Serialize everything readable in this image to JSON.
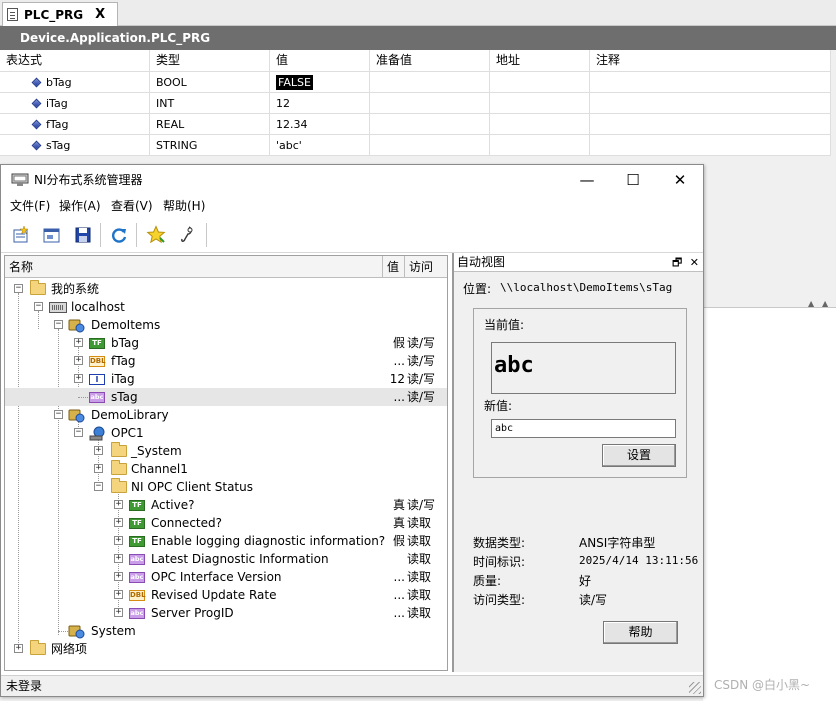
{
  "editor": {
    "tab_title": "PLC_PRG",
    "tab_close": "X",
    "path": "Device.Application.PLC_PRG",
    "columns": [
      "表达式",
      "类型",
      "值",
      "准备值",
      "地址",
      "注释"
    ],
    "rows": [
      {
        "expr": "bTag",
        "type": "BOOL",
        "value": "FALSE"
      },
      {
        "expr": "iTag",
        "type": "INT",
        "value": "12"
      },
      {
        "expr": "fTag",
        "type": "REAL",
        "value": "12.34"
      },
      {
        "expr": "sTag",
        "type": "STRING",
        "value": "'abc'"
      }
    ]
  },
  "window": {
    "title": "NI分布式系统管理器",
    "controls": {
      "minimize": "—",
      "maximize": "☐",
      "close": "✕"
    }
  },
  "menu": [
    "文件(F)",
    "操作(A)",
    "查看(V)",
    "帮助(H)"
  ],
  "toolbar_icons": [
    "new-item-icon",
    "properties-icon",
    "save-icon",
    "refresh-icon",
    "favorite-star-icon",
    "probe-icon"
  ],
  "tree": {
    "columns": {
      "name": "名称",
      "value": "值",
      "access": "访问"
    },
    "nodes": {
      "my_system": "我的系统",
      "localhost": "localhost",
      "demo_items": "DemoItems",
      "btag": {
        "name": "bTag",
        "value": "假",
        "access": "读/写"
      },
      "ftag": {
        "name": "fTag",
        "value": "...",
        "access": "读/写"
      },
      "itag": {
        "name": "iTag",
        "value": "12",
        "access": "读/写"
      },
      "stag": {
        "name": "sTag",
        "value": "...",
        "access": "读/写"
      },
      "demo_library": "DemoLibrary",
      "opc1": "OPC1",
      "system_folder": "_System",
      "channel1": "Channel1",
      "opc_status": "NI OPC Client Status",
      "active": {
        "name": "Active?",
        "value": "真",
        "access": "读/写"
      },
      "connected": {
        "name": "Connected?",
        "value": "真",
        "access": "读取"
      },
      "enable_logging": {
        "name": "Enable logging diagnostic information?",
        "value": "假",
        "access": "读取"
      },
      "latest_diag": {
        "name": "Latest Diagnostic Information",
        "value": "",
        "access": "读取"
      },
      "opc_iface": {
        "name": "OPC Interface Version",
        "value": "...",
        "access": "读取"
      },
      "revised_rate": {
        "name": "Revised Update Rate",
        "value": "...",
        "access": "读取"
      },
      "server_progid": {
        "name": "Server ProgID",
        "value": "...",
        "access": "读取"
      },
      "system": "System",
      "network": "网络项"
    }
  },
  "auto_view": {
    "title": "自动视图",
    "location_label": "位置:",
    "location_value": "\\\\localhost\\DemoItems\\sTag",
    "current_label": "当前值:",
    "current_value": "abc",
    "new_label": "新值:",
    "new_value": "abc",
    "set_button": "设置",
    "info": [
      {
        "label": "数据类型:",
        "value": "ANSI字符串型"
      },
      {
        "label": "时间标识:",
        "value": "2025/4/14 13:11:56"
      },
      {
        "label": "质量:",
        "value": "好"
      },
      {
        "label": "访问类型:",
        "value": "读/写"
      }
    ],
    "help_button": "帮助"
  },
  "status": "未登录",
  "watermark": "CSDN @白小黑~"
}
